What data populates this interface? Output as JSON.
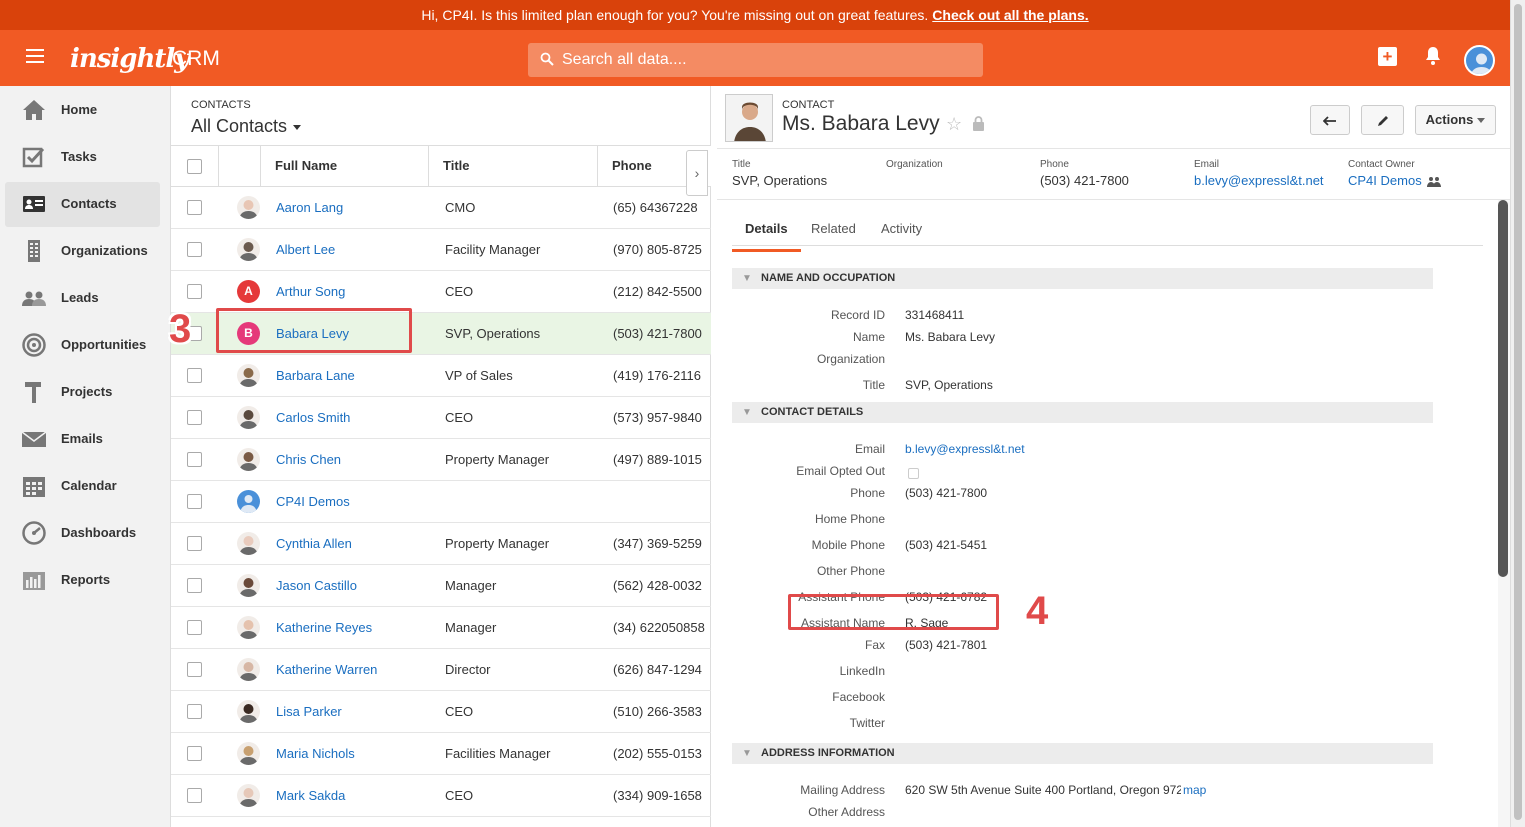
{
  "banner": {
    "text": "Hi, CP4I. Is this limited plan enough for you? You're missing out on great features.",
    "link": "Check out all the plans."
  },
  "topbar": {
    "brand": "insightly",
    "product": "CRM",
    "search_placeholder": "Search all data...."
  },
  "nav": [
    {
      "label": "Home",
      "icon": "home-icon"
    },
    {
      "label": "Tasks",
      "icon": "tasks-icon"
    },
    {
      "label": "Contacts",
      "icon": "contacts-icon",
      "active": true
    },
    {
      "label": "Organizations",
      "icon": "organizations-icon"
    },
    {
      "label": "Leads",
      "icon": "leads-icon"
    },
    {
      "label": "Opportunities",
      "icon": "opportunities-icon"
    },
    {
      "label": "Projects",
      "icon": "projects-icon"
    },
    {
      "label": "Emails",
      "icon": "emails-icon"
    },
    {
      "label": "Calendar",
      "icon": "calendar-icon"
    },
    {
      "label": "Dashboards",
      "icon": "dashboards-icon"
    },
    {
      "label": "Reports",
      "icon": "reports-icon"
    }
  ],
  "list": {
    "caption": "CONTACTS",
    "view": "All Contacts",
    "columns": {
      "name": "Full Name",
      "title": "Title",
      "phone": "Phone"
    },
    "rows": [
      {
        "name": "Aaron Lang",
        "title": "CMO",
        "phone": "(65) 64367228",
        "avatar": "photo",
        "color": "#e8c6b4"
      },
      {
        "name": "Albert Lee",
        "title": "Facility Manager",
        "phone": "(970) 805-8725",
        "avatar": "photo",
        "color": "#6b5a4e"
      },
      {
        "name": "Arthur Song",
        "title": "CEO",
        "phone": "(212) 842-5500",
        "avatar": "letter",
        "letter": "A",
        "color": "#e5393a"
      },
      {
        "name": "Babara Levy",
        "title": "SVP, Operations",
        "phone": "(503) 421-7800",
        "avatar": "letter",
        "letter": "B",
        "color": "#e5397a",
        "selected": true
      },
      {
        "name": "Barbara Lane",
        "title": "VP of Sales",
        "phone": "(419) 176-2116",
        "avatar": "photo",
        "color": "#8a6a4a"
      },
      {
        "name": "Carlos Smith",
        "title": "CEO",
        "phone": "(573) 957-9840",
        "avatar": "photo",
        "color": "#5b4a3e"
      },
      {
        "name": "Chris Chen",
        "title": "Property Manager",
        "phone": "(497) 889-1015",
        "avatar": "photo",
        "color": "#7a5a44"
      },
      {
        "name": "CP4I Demos",
        "title": "",
        "phone": "",
        "avatar": "user",
        "color": "#4a90d9"
      },
      {
        "name": "Cynthia Allen",
        "title": "Property Manager",
        "phone": "(347) 369-5259",
        "avatar": "photo",
        "color": "#e9cbbd"
      },
      {
        "name": "Jason Castillo",
        "title": "Manager",
        "phone": "(562) 428-0032",
        "avatar": "photo",
        "color": "#6b4a3a"
      },
      {
        "name": "Katherine Reyes",
        "title": "Manager",
        "phone": "(34) 622050858",
        "avatar": "photo",
        "color": "#e5c2ad"
      },
      {
        "name": "Katherine Warren",
        "title": "Director",
        "phone": "(626) 847-1294",
        "avatar": "photo",
        "color": "#d7b7a5"
      },
      {
        "name": "Lisa Parker",
        "title": "CEO",
        "phone": "(510) 266-3583",
        "avatar": "photo",
        "color": "#3a2a22"
      },
      {
        "name": "Maria Nichols",
        "title": "Facilities Manager",
        "phone": "(202) 555-0153",
        "avatar": "photo",
        "color": "#c8a070"
      },
      {
        "name": "Mark Sakda",
        "title": "CEO",
        "phone": "(334) 909-1658",
        "avatar": "photo",
        "color": "#e6c8b8"
      }
    ]
  },
  "detail": {
    "caption": "CONTACT",
    "name": "Ms. Babara Levy",
    "actions_label": "Actions",
    "summary": [
      {
        "label": "Title",
        "value": "SVP, Operations",
        "link": false
      },
      {
        "label": "Organization",
        "value": "",
        "link": false
      },
      {
        "label": "Phone",
        "value": "(503) 421-7800",
        "link": false
      },
      {
        "label": "Email",
        "value": "b.levy@expressl&t.net",
        "link": true
      },
      {
        "label": "Contact Owner",
        "value": "CP4I Demos",
        "link": true
      }
    ],
    "tabs": [
      "Details",
      "Related",
      "Activity"
    ],
    "sections": {
      "name_occupation": {
        "title": "NAME AND OCCUPATION",
        "fields": [
          {
            "label": "Record ID",
            "value": "331468411"
          },
          {
            "label": "Name",
            "value": "Ms. Babara Levy"
          },
          {
            "label": "Organization",
            "value": ""
          },
          {
            "label": "Title",
            "value": "SVP, Operations"
          }
        ]
      },
      "contact_details": {
        "title": "CONTACT DETAILS",
        "fields": [
          {
            "label": "Email",
            "value": "b.levy@expressl&t.net",
            "link": true
          },
          {
            "label": "Email Opted Out",
            "value": "",
            "checkbox": true
          },
          {
            "label": "Phone",
            "value": "(503) 421-7800"
          },
          {
            "label": "Home Phone",
            "value": ""
          },
          {
            "label": "Mobile Phone",
            "value": "(503) 421-5451"
          },
          {
            "label": "Other Phone",
            "value": ""
          },
          {
            "label": "Assistant Phone",
            "value": "(503) 421-6782"
          },
          {
            "label": "Assistant Name",
            "value": "R. Sage"
          },
          {
            "label": "Fax",
            "value": "(503) 421-7801"
          },
          {
            "label": "LinkedIn",
            "value": ""
          },
          {
            "label": "Facebook",
            "value": ""
          },
          {
            "label": "Twitter",
            "value": ""
          }
        ]
      },
      "address": {
        "title": "ADDRESS INFORMATION",
        "fields": [
          {
            "label": "Mailing Address",
            "value": "620 SW 5th Avenue Suite 400 Portland, Oregon 972",
            "map": "map"
          },
          {
            "label": "Other Address",
            "value": ""
          }
        ]
      }
    }
  },
  "annotations": {
    "step3": "3",
    "step4": "4"
  }
}
